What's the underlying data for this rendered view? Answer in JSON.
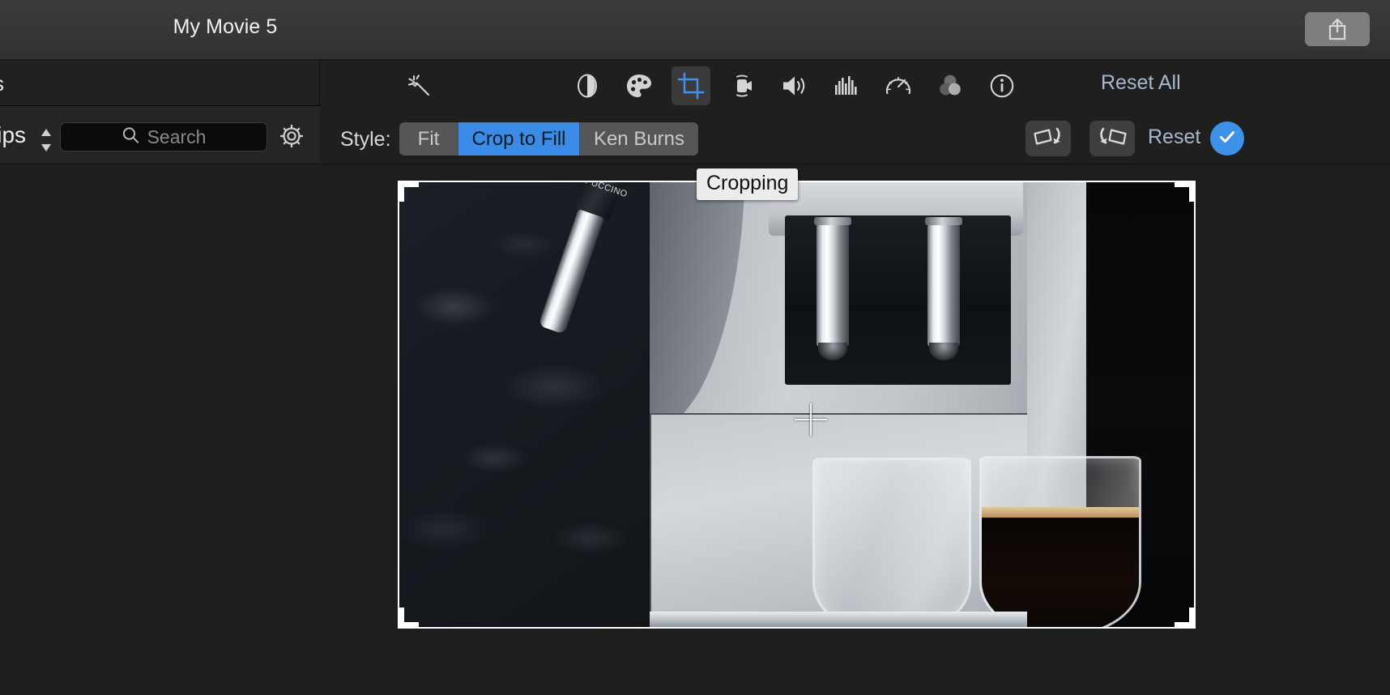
{
  "window": {
    "title": "My Movie 5",
    "share_icon": "share-export-icon"
  },
  "sidebar": {
    "top_partial_label": "s",
    "clips_label": "lips",
    "sort_stepper_icon": "sort-stepper-icon",
    "search": {
      "placeholder": "Search",
      "value": "",
      "icon": "search-icon"
    },
    "settings_icon": "gear-icon"
  },
  "inspector": {
    "tools": [
      {
        "name": "enhance-icon",
        "label": "Auto Enhance",
        "selected": false
      },
      {
        "name": "color-balance-icon",
        "label": "Color Balance",
        "selected": false
      },
      {
        "name": "color-correct-icon",
        "label": "Color Correction",
        "selected": false
      },
      {
        "name": "crop-icon",
        "label": "Cropping",
        "selected": true
      },
      {
        "name": "stabilization-icon",
        "label": "Stabilization",
        "selected": false
      },
      {
        "name": "volume-icon",
        "label": "Volume",
        "selected": false
      },
      {
        "name": "equalizer-icon",
        "label": "Noise Reduction and Equalizer",
        "selected": false
      },
      {
        "name": "speed-icon",
        "label": "Speed",
        "selected": false
      },
      {
        "name": "clip-filter-icon",
        "label": "Clip Filter and Audio Effects",
        "selected": false
      },
      {
        "name": "info-icon",
        "label": "Information",
        "selected": false
      }
    ],
    "reset_all_label": "Reset All",
    "tooltip": "Cropping"
  },
  "style_row": {
    "label": "Style:",
    "options": [
      {
        "label": "Fit",
        "selected": false
      },
      {
        "label": "Crop to Fill",
        "selected": true
      },
      {
        "label": "Ken Burns",
        "selected": false
      }
    ],
    "rotate_ccw_icon": "rotate-counterclockwise-icon",
    "rotate_cw_icon": "rotate-clockwise-icon",
    "reset_label": "Reset",
    "apply_icon": "checkmark-icon"
  },
  "viewer": {
    "scene_caption": "espresso machine pouring into two glass cups",
    "wand_text": "PUCCINO",
    "cursor": "crosshair-cursor",
    "crop_handles": [
      "top-left",
      "top-right",
      "bottom-left",
      "bottom-right"
    ]
  },
  "colors": {
    "accent_blue": "#3b8ce8",
    "apply_blue": "#3e91e8",
    "link_blue": "#a5b8cc",
    "window_chrome": "#363636",
    "panel_bg": "#1f1f1f"
  }
}
